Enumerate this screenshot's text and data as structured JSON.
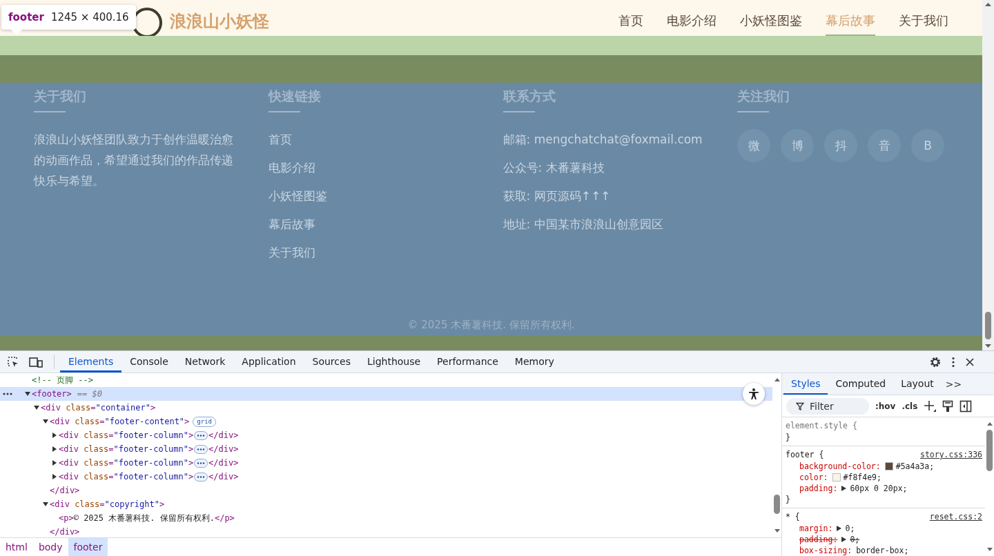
{
  "tooltip": {
    "tag": "footer",
    "size": "1245 × 400.16"
  },
  "site": {
    "logo": "浪浪山小妖怪",
    "nav": [
      {
        "label": "首页",
        "selected": false
      },
      {
        "label": "电影介绍",
        "selected": false
      },
      {
        "label": "小妖怪图鉴",
        "selected": false
      },
      {
        "label": "幕后故事",
        "selected": true
      },
      {
        "label": "关于我们",
        "selected": false
      }
    ],
    "footer": {
      "columns": [
        {
          "heading": "关于我们",
          "kind": "text",
          "text": "浪浪山小妖怪团队致力于创作温暖治愈的动画作品，希望通过我们的作品传递快乐与希望。"
        },
        {
          "heading": "快速链接",
          "kind": "links",
          "items": [
            "首页",
            "电影介绍",
            "小妖怪图鉴",
            "幕后故事",
            "关于我们"
          ]
        },
        {
          "heading": "联系方式",
          "kind": "lines",
          "items": [
            "邮箱: mengchatchat@foxmail.com",
            "公众号: 木番薯科技",
            "获取: 网页源码↑↑↑",
            "地址: 中国某市浪浪山创意园区"
          ]
        },
        {
          "heading": "关注我们",
          "kind": "social",
          "items": [
            "微",
            "博",
            "抖",
            "音",
            "B"
          ]
        }
      ],
      "copyright": "© 2025 木番薯科技. 保留所有权利."
    }
  },
  "devtools": {
    "tabs": [
      {
        "label": "Elements",
        "selected": true
      },
      {
        "label": "Console",
        "selected": false
      },
      {
        "label": "Network",
        "selected": false
      },
      {
        "label": "Application",
        "selected": false
      },
      {
        "label": "Sources",
        "selected": false
      },
      {
        "label": "Lighthouse",
        "selected": false
      },
      {
        "label": "Performance",
        "selected": false
      },
      {
        "label": "Memory",
        "selected": false
      }
    ],
    "dom": [
      {
        "selected": false,
        "open": [
          {
            "kind": "comment",
            "s": "<!-- 页脚 -->"
          }
        ]
      },
      {
        "selected": true,
        "expanded": true,
        "open": [
          {
            "kind": "tag",
            "s": "<footer>"
          }
        ],
        "suffix": "== $0",
        "children": [
          {
            "selected": false,
            "expanded": true,
            "open": [
              {
                "kind": "tag",
                "s": "<div"
              },
              {
                "kind": "attr",
                "s": " class"
              },
              {
                "kind": "tag",
                "s": "="
              },
              {
                "kind": "value",
                "s": "\"container\""
              },
              {
                "kind": "tag",
                "s": ">"
              }
            ],
            "children": [
              {
                "selected": false,
                "expanded": true,
                "open": [
                  {
                    "kind": "tag",
                    "s": "<div"
                  },
                  {
                    "kind": "attr",
                    "s": " class"
                  },
                  {
                    "kind": "tag",
                    "s": "="
                  },
                  {
                    "kind": "value",
                    "s": "\"footer-content\""
                  },
                  {
                    "kind": "tag",
                    "s": ">"
                  }
                ],
                "badge": "grid",
                "close": [
                  {
                    "kind": "tag",
                    "s": "</div>"
                  }
                ],
                "children": [
                  {
                    "selected": false,
                    "expanded": false,
                    "open": [
                      {
                        "kind": "tag",
                        "s": "<div"
                      },
                      {
                        "kind": "attr",
                        "s": " class"
                      },
                      {
                        "kind": "tag",
                        "s": "="
                      },
                      {
                        "kind": "value",
                        "s": "\"footer-column\""
                      },
                      {
                        "kind": "tag",
                        "s": ">"
                      }
                    ],
                    "close": [
                      {
                        "kind": "tag",
                        "s": "</div>"
                      }
                    ]
                  },
                  {
                    "selected": false,
                    "expanded": false,
                    "open": [
                      {
                        "kind": "tag",
                        "s": "<div"
                      },
                      {
                        "kind": "attr",
                        "s": " class"
                      },
                      {
                        "kind": "tag",
                        "s": "="
                      },
                      {
                        "kind": "value",
                        "s": "\"footer-column\""
                      },
                      {
                        "kind": "tag",
                        "s": ">"
                      }
                    ],
                    "close": [
                      {
                        "kind": "tag",
                        "s": "</div>"
                      }
                    ]
                  },
                  {
                    "selected": false,
                    "expanded": false,
                    "open": [
                      {
                        "kind": "tag",
                        "s": "<div"
                      },
                      {
                        "kind": "attr",
                        "s": " class"
                      },
                      {
                        "kind": "tag",
                        "s": "="
                      },
                      {
                        "kind": "value",
                        "s": "\"footer-column\""
                      },
                      {
                        "kind": "tag",
                        "s": ">"
                      }
                    ],
                    "close": [
                      {
                        "kind": "tag",
                        "s": "</div>"
                      }
                    ]
                  },
                  {
                    "selected": false,
                    "expanded": false,
                    "open": [
                      {
                        "kind": "tag",
                        "s": "<div"
                      },
                      {
                        "kind": "attr",
                        "s": " class"
                      },
                      {
                        "kind": "tag",
                        "s": "="
                      },
                      {
                        "kind": "value",
                        "s": "\"footer-column\""
                      },
                      {
                        "kind": "tag",
                        "s": ">"
                      }
                    ],
                    "close": [
                      {
                        "kind": "tag",
                        "s": "</div>"
                      }
                    ]
                  }
                ]
              },
              {
                "selected": false,
                "expanded": true,
                "open": [
                  {
                    "kind": "tag",
                    "s": "<div"
                  },
                  {
                    "kind": "attr",
                    "s": " class"
                  },
                  {
                    "kind": "tag",
                    "s": "="
                  },
                  {
                    "kind": "value",
                    "s": "\"copyright\""
                  },
                  {
                    "kind": "tag",
                    "s": ">"
                  }
                ],
                "close": [
                  {
                    "kind": "tag",
                    "s": "</div>"
                  }
                ],
                "children": [
                  {
                    "selected": false,
                    "open": [
                      {
                        "kind": "tag",
                        "s": "<p>"
                      },
                      {
                        "kind": "text",
                        "s": "© 2025 木番薯科技. 保留所有权利."
                      },
                      {
                        "kind": "tag",
                        "s": "</p>"
                      }
                    ]
                  }
                ]
              }
            ]
          }
        ]
      }
    ],
    "breadcrumbs": [
      {
        "label": "html",
        "selected": false
      },
      {
        "label": "body",
        "selected": false
      },
      {
        "label": "footer",
        "selected": true
      }
    ],
    "side_tabs": [
      {
        "label": "Styles",
        "selected": true
      },
      {
        "label": "Computed",
        "selected": false
      },
      {
        "label": "Layout",
        "selected": false
      }
    ],
    "more_tabs": ">>",
    "filter": {
      "placeholder": "Filter"
    },
    "hov": ":hov",
    "cls": ".cls",
    "rules": [
      {
        "selector": "element.style {",
        "close": "}"
      },
      {
        "selector": "footer {",
        "source": "story.css:336",
        "close": "}",
        "props": [
          {
            "name": "background-color:",
            "value": "#5a4a3a;",
            "color": "#5a4a3a",
            "struck": false
          },
          {
            "name": "color:",
            "value": "#f8f4e9;",
            "color": "#f8f4e9",
            "struck": false
          },
          {
            "name": "padding:",
            "value": "60px 0 20px;",
            "kind": "shorthand",
            "struck": false
          }
        ]
      },
      {
        "selector": "* {",
        "source": "reset.css:2",
        "props": [
          {
            "name": "margin:",
            "value": "0;",
            "kind": "shorthand",
            "struck": false
          },
          {
            "name": "padding:",
            "value": "0;",
            "kind": "shorthand",
            "struck": true
          },
          {
            "name": "box-sizing:",
            "value": "border-box;",
            "struck": false
          }
        ]
      }
    ]
  }
}
